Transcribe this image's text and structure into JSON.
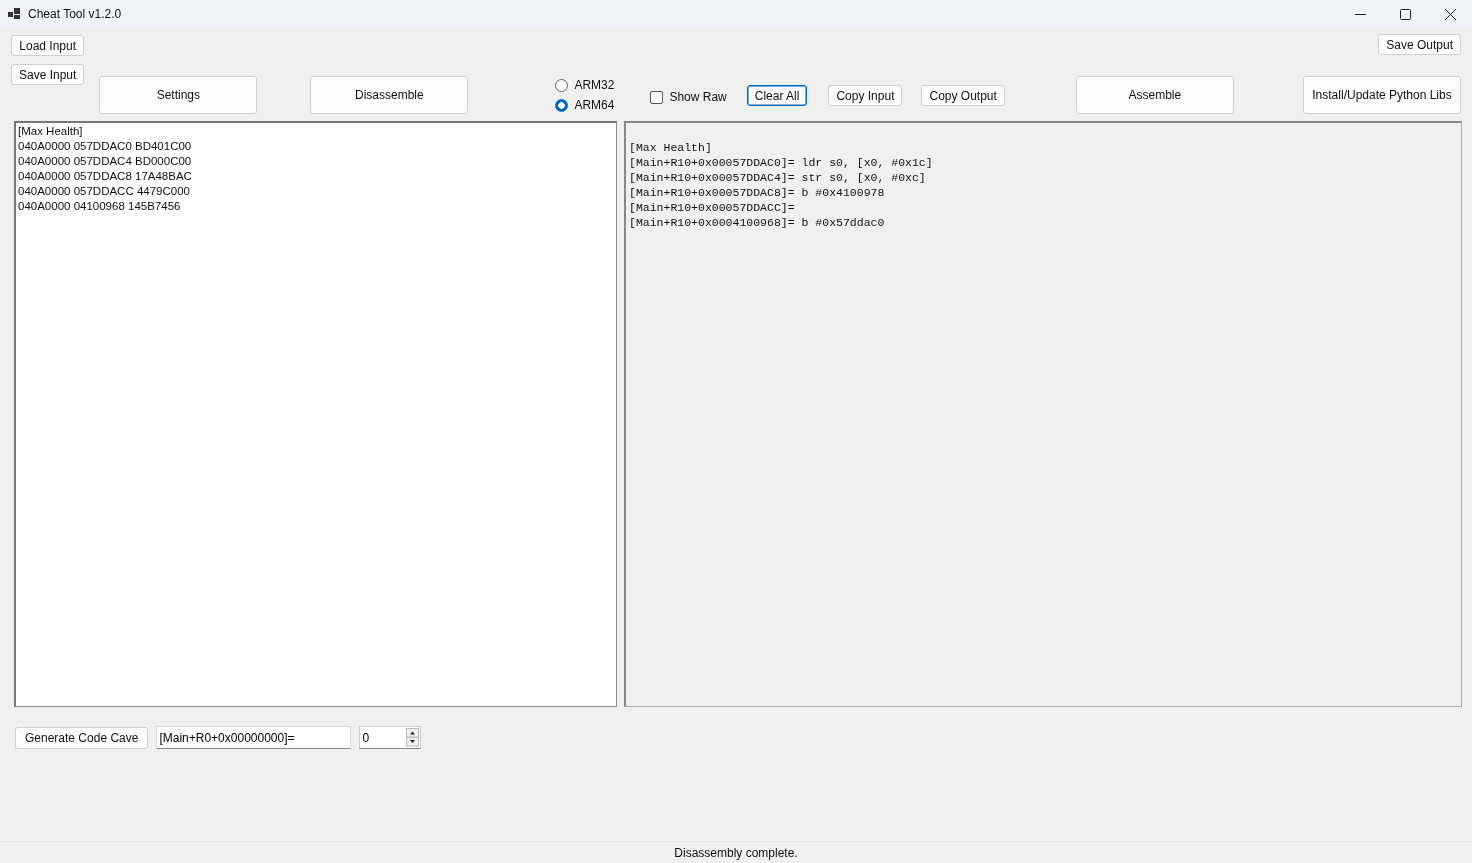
{
  "window": {
    "title": "Cheat Tool v1.2.0"
  },
  "toolbar": {
    "load_input": "Load Input",
    "save_input": "Save Input",
    "settings": "Settings",
    "disassemble": "Disassemble",
    "architectures": [
      {
        "label": "ARM32",
        "selected": false
      },
      {
        "label": "ARM64",
        "selected": true
      }
    ],
    "show_raw": {
      "label": "Show Raw",
      "checked": false
    },
    "clear_all": {
      "label": "Clear All",
      "focused": true
    },
    "copy_input": "Copy Input",
    "copy_output": "Copy Output",
    "assemble": "Assemble",
    "save_output": "Save Output",
    "install_libs": "Install/Update Python Libs"
  },
  "input_lines": [
    "[Max Health]",
    "040A0000 057DDAC0 BD401C00",
    "040A0000 057DDAC4 BD000C00",
    "040A0000 057DDAC8 17A48BAC",
    "040A0000 057DDACC 4479C000",
    "040A0000 04100968 145B7456"
  ],
  "output_lines": [
    "[Max Health]",
    "[Main+R10+0x00057DDAC0]= ldr s0, [x0, #0x1c]",
    "[Main+R10+0x00057DDAC4]= str s0, [x0, #0xc]",
    "[Main+R10+0x00057DDAC8]= b #0x4100978",
    "[Main+R10+0x00057DDACC]=",
    "[Main+R10+0x0004100968]= b #0x57ddac0"
  ],
  "code_cave": {
    "button": "Generate Code Cave",
    "address": "[Main+R0+0x00000000]=",
    "count": "0"
  },
  "status_bar": "Disassembly complete."
}
